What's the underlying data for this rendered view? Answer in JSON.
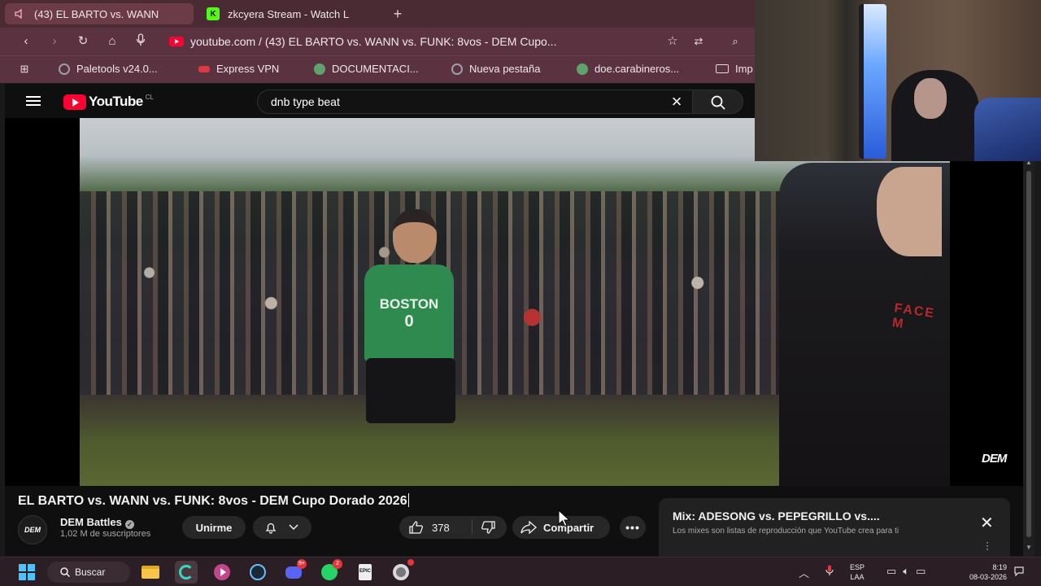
{
  "browser": {
    "tabs": [
      {
        "label": "(43) EL BARTO vs. WANN",
        "active": true
      },
      {
        "label": "zkcyera Stream - Watch L",
        "active": false
      }
    ],
    "new_tab_label": "+",
    "address": "youtube.com / (43) EL BARTO vs. WANN vs. FUNK: 8vos - DEM Cupo...",
    "bookmarks": [
      {
        "label": "Paletools v24.0...",
        "color": "#9aa0a6"
      },
      {
        "label": "Express VPN",
        "color": "#da3940"
      },
      {
        "label": "DOCUMENTACI...",
        "color": "#5fa26b"
      },
      {
        "label": "Nueva pestaña",
        "color": "#9aa0a6"
      },
      {
        "label": "doe.carabineros...",
        "color": "#5fa26b"
      },
      {
        "label": "Imp",
        "color": "#e6d8dc"
      }
    ]
  },
  "youtube": {
    "logo_text": "YouTube",
    "country_code": "CL",
    "search_query": "dnb type beat",
    "video_watermark": "DEM",
    "jersey_text": "BOSTON",
    "jersey_number": "0",
    "shirt_print_text": "FACE M",
    "video_title": "EL BARTO vs. WANN vs. FUNK: 8vos - DEM Cupo Dorado 2026",
    "channel": {
      "avatar_text": "DEM",
      "name": "DEM Battles",
      "subscribers": "1,02 M de suscriptores"
    },
    "subscribe_label": "Unirme",
    "like_count": "378",
    "share_label": "Compartir",
    "more_label": "•••",
    "mix": {
      "title": "Mix: ADESONG vs. PEPEGRILLO vs....",
      "description": "Los mixes son listas de reproducción que YouTube crea para ti"
    }
  },
  "taskbar": {
    "search_label": "Buscar",
    "badges": {
      "discord": "9+",
      "whatsapp": "2"
    },
    "epic_label": "EPIC",
    "language": {
      "line1": "ESP",
      "line2": "LAA"
    },
    "time": "8:19",
    "date": "08-03-2026"
  },
  "colors": {
    "tab_bar": "#4a2a33",
    "toolbar": "#5a3240",
    "youtube_bg": "#0f0f0f",
    "youtube_red": "#ff0033",
    "taskbar": "#2b1e24"
  }
}
